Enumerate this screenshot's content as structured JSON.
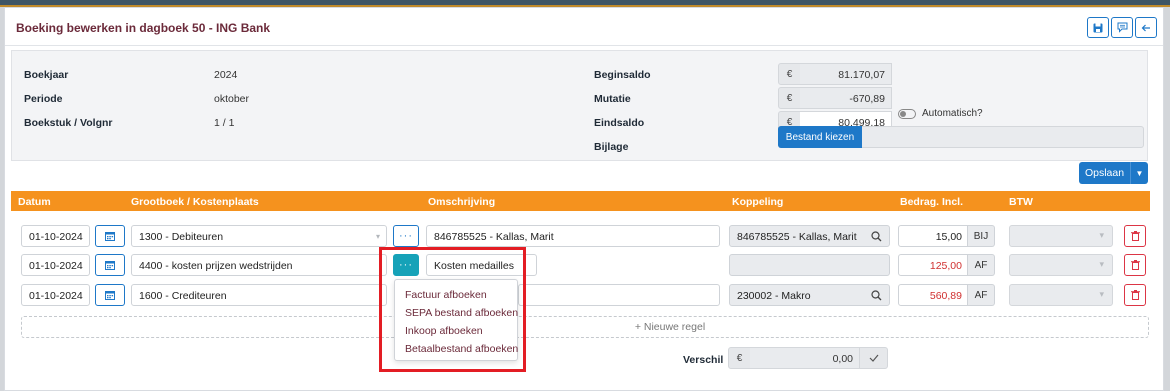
{
  "header": {
    "title": "Boeking bewerken in dagboek 50 - ING Bank"
  },
  "info": {
    "boekjaar_label": "Boekjaar",
    "boekjaar_value": "2024",
    "periode_label": "Periode",
    "periode_value": "oktober",
    "boekstuk_label": "Boekstuk / Volgnr",
    "boekstuk_value": "1 / 1",
    "beginsaldo_label": "Beginsaldo",
    "beginsaldo_value": "81.170,07",
    "mutatie_label": "Mutatie",
    "mutatie_value": "-670,89",
    "eindsaldo_label": "Eindsaldo",
    "eindsaldo_value": "80.499,18",
    "automatisch_label": "Automatisch?",
    "bijlage_label": "Bijlage",
    "bestand_button": "Bestand kiezen",
    "currency": "€"
  },
  "toolbar": {
    "save_label": "Opslaan"
  },
  "table": {
    "headers": [
      "Datum",
      "Grootboek / Kostenplaats",
      "Omschrijving",
      "Koppeling",
      "Bedrag. Incl.",
      "BTW"
    ],
    "rows": [
      {
        "datum": "01-10-2024",
        "grootboek": "1300 - Debiteuren",
        "omschrijving": "846785525 - Kallas, Marit",
        "koppeling": "846785525 - Kallas, Marit",
        "bedrag": "15,00",
        "type": "BIJ"
      },
      {
        "datum": "01-10-2024",
        "grootboek": "4400 - kosten prijzen wedstrijden",
        "omschrijving": "Kosten medailles",
        "koppeling": "",
        "bedrag": "125,00",
        "type": "AF"
      },
      {
        "datum": "01-10-2024",
        "grootboek": "1600 - Crediteuren",
        "omschrijving": "",
        "koppeling": "230002 - Makro",
        "bedrag": "560,89",
        "type": "AF"
      }
    ],
    "new_row_label": "+ Nieuwe regel"
  },
  "footer": {
    "verschil_label": "Verschil",
    "verschil_value": "0,00",
    "currency": "€"
  },
  "dropdown": {
    "items": [
      "Factuur afboeken",
      "SEPA bestand afboeken",
      "Inkoop afboeken",
      "Betaalbestand afboeken"
    ]
  },
  "colors": {
    "primary": "#1e78c8",
    "table_header": "#f5921e",
    "title": "#6b2a3a",
    "negative": "#d03030",
    "highlight_frame": "#e31d24"
  }
}
